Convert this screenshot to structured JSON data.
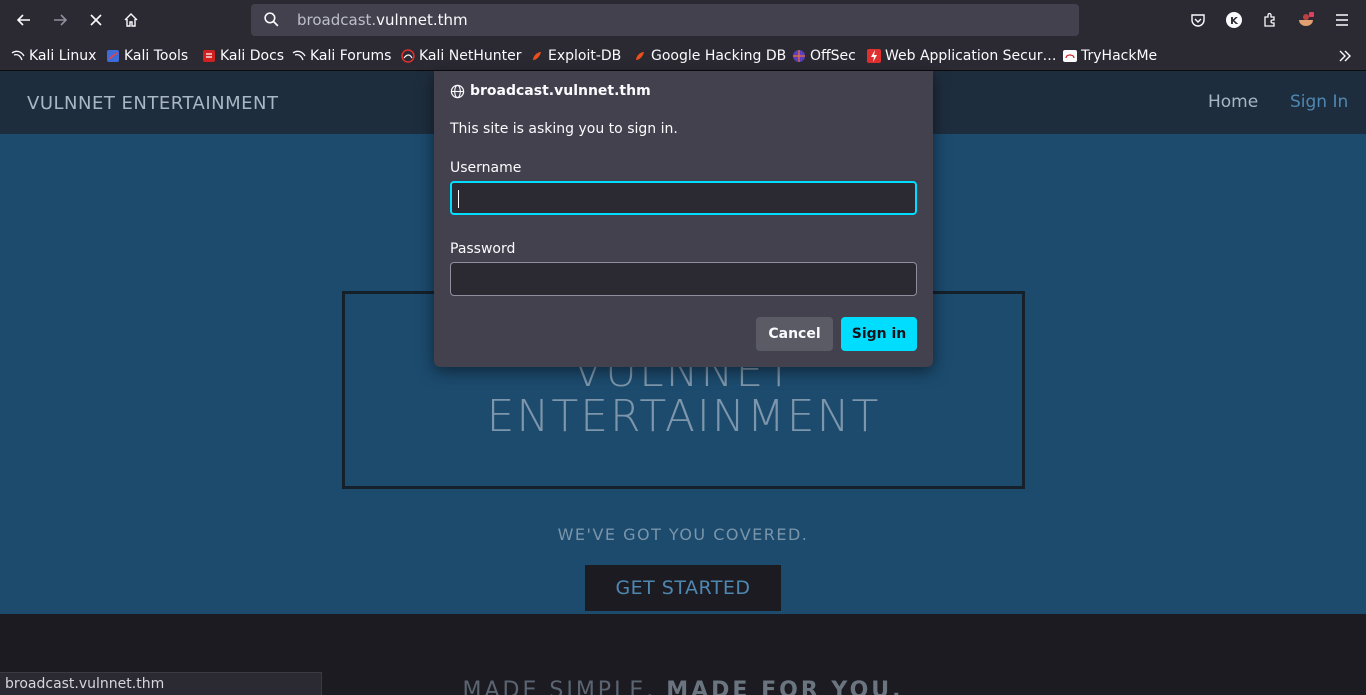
{
  "browser": {
    "url_host_prefix": "broadcast.",
    "url_domain": "vulnnet.thm",
    "status_text": "broadcast.vulnnet.thm"
  },
  "bookmarks": [
    {
      "label": "Kali Linux",
      "icon": "kali-dragon-icon"
    },
    {
      "label": "Kali Tools",
      "icon": "kali-tools-icon"
    },
    {
      "label": "Kali Docs",
      "icon": "kali-docs-icon"
    },
    {
      "label": "Kali Forums",
      "icon": "kali-dragon-icon"
    },
    {
      "label": "Kali NetHunter",
      "icon": "nethunter-icon"
    },
    {
      "label": "Exploit-DB",
      "icon": "exploit-db-icon"
    },
    {
      "label": "Google Hacking DB",
      "icon": "exploit-db-icon"
    },
    {
      "label": "OffSec",
      "icon": "offsec-icon"
    },
    {
      "label": "Web Application Secur…",
      "icon": "bolt-icon"
    },
    {
      "label": "TryHackMe",
      "icon": "tryhackme-icon"
    }
  ],
  "site": {
    "brand": "VULNNET ENTERTAINMENT",
    "nav": {
      "home": "Home",
      "signin": "Sign In"
    },
    "hero_title_line1": "VULNNET",
    "hero_title_line2": "ENTERTAINMENT",
    "tagline": "WE'VE GOT YOU COVERED.",
    "cta": "GET STARTED",
    "lower_light": "MADE SIMPLE.",
    "lower_bold": "MADE FOR YOU."
  },
  "auth_dialog": {
    "origin": "broadcast.vulnnet.thm",
    "message": "This site is asking you to sign in.",
    "username_label": "Username",
    "username_value": "",
    "password_label": "Password",
    "password_value": "",
    "cancel": "Cancel",
    "signin": "Sign in"
  },
  "colors": {
    "accent": "#00ddff",
    "hero_bg": "#1c4b6e",
    "nav_bg": "#1e2d3d"
  }
}
